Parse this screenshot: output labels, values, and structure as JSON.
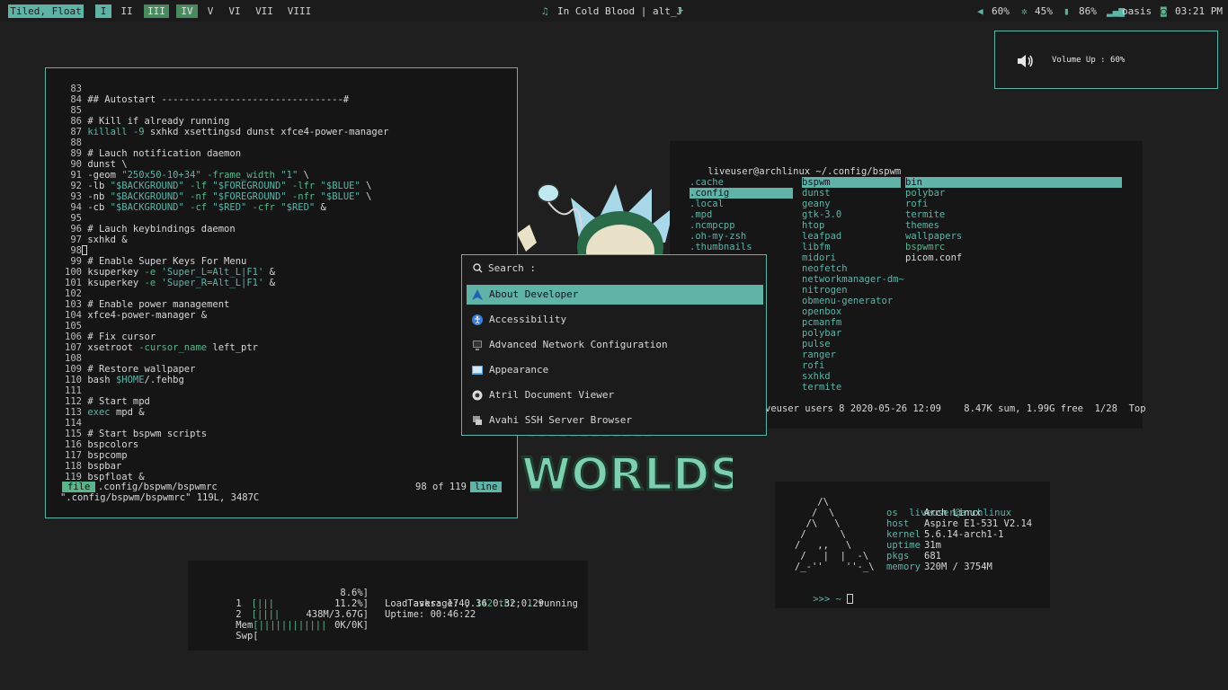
{
  "topbar": {
    "layout": "Tiled, Float",
    "workspaces": [
      {
        "label": "I",
        "state": "active"
      },
      {
        "label": "II",
        "state": "normal"
      },
      {
        "label": "III",
        "state": "occupied"
      },
      {
        "label": "IV",
        "state": "occupied"
      },
      {
        "label": "V",
        "state": "normal"
      },
      {
        "label": "VI",
        "state": "normal"
      },
      {
        "label": "VII",
        "state": "normal"
      },
      {
        "label": "VIII",
        "state": "normal"
      }
    ],
    "music_icon": "music-note-icon",
    "song": "In Cold Blood | alt_J",
    "play_icon": "play-icon",
    "volume": "60%",
    "brightness": "45%",
    "battery": "86%",
    "network": "oasis",
    "time": "03:21 PM"
  },
  "notification": {
    "icon": "speaker-icon",
    "text": "Volume Up : 60%"
  },
  "editor": {
    "lines": [
      {
        "n": "83",
        "t": ""
      },
      {
        "n": "84",
        "t": "## Autostart --------------------------------#"
      },
      {
        "n": "85",
        "t": ""
      },
      {
        "n": "86",
        "t": "# Kill if already running"
      },
      {
        "n": "87",
        "a": "killall",
        "b": " -9",
        "c": " sxhkd xsettingsd dunst xfce4-power-manager"
      },
      {
        "n": "88",
        "t": ""
      },
      {
        "n": "89",
        "t": "# Lauch notification daemon"
      },
      {
        "n": "90",
        "t": "dunst \\"
      },
      {
        "n": "91",
        "a": "-geom ",
        "b": "\"250x50-10+34\"",
        "c": " -frame_width ",
        "d": "\"1\"",
        "e": " \\"
      },
      {
        "n": "92",
        "a": "-lb ",
        "b": "\"$BACKGROUND\"",
        "c": " -lf ",
        "d": "\"$FOREGROUND\"",
        "e": " -lfr ",
        "f": "\"$BLUE\"",
        "g": " \\"
      },
      {
        "n": "93",
        "a": "-nb ",
        "b": "\"$BACKGROUND\"",
        "c": " -nf ",
        "d": "\"$FOREGROUND\"",
        "e": " -nfr ",
        "f": "\"$BLUE\"",
        "g": " \\"
      },
      {
        "n": "94",
        "a": "-cb ",
        "b": "\"$BACKGROUND\"",
        "c": " -cf ",
        "d": "\"$RED\"",
        "e": " -cfr ",
        "f": "\"$RED\"",
        "g": " &"
      },
      {
        "n": "95",
        "t": ""
      },
      {
        "n": "96",
        "t": "# Lauch keybindings daemon"
      },
      {
        "n": "97",
        "t": "sxhkd &"
      },
      {
        "n": "98",
        "t": ""
      },
      {
        "n": "99",
        "t": "# Enable Super Keys For Menu"
      },
      {
        "n": "100",
        "a": "ksuperkey ",
        "b": "-e ",
        "c": "'Super_L=Alt_L|F1'",
        "d": " &"
      },
      {
        "n": "101",
        "a": "ksuperkey ",
        "b": "-e ",
        "c": "'Super_R=Alt_L|F1'",
        "d": " &"
      },
      {
        "n": "102",
        "t": ""
      },
      {
        "n": "103",
        "t": "# Enable power management"
      },
      {
        "n": "104",
        "t": "xfce4-power-manager &"
      },
      {
        "n": "105",
        "t": ""
      },
      {
        "n": "106",
        "t": "# Fix cursor"
      },
      {
        "n": "107",
        "a": "xsetroot ",
        "b": "-cursor_name",
        "c": " left_ptr"
      },
      {
        "n": "108",
        "t": ""
      },
      {
        "n": "109",
        "t": "# Restore wallpaper"
      },
      {
        "n": "110",
        "a": "bash ",
        "b": "$HOME",
        "c": "/.fehbg"
      },
      {
        "n": "111",
        "t": ""
      },
      {
        "n": "112",
        "t": "# Start mpd"
      },
      {
        "n": "113",
        "a": "exec",
        "b": " mpd &"
      },
      {
        "n": "114",
        "t": ""
      },
      {
        "n": "115",
        "t": "# Start bspwm scripts"
      },
      {
        "n": "116",
        "t": "bspcolors"
      },
      {
        "n": "117",
        "t": "bspcomp"
      },
      {
        "n": "118",
        "t": "bspbar"
      },
      {
        "n": "119",
        "t": "bspfloat &"
      }
    ],
    "status_mode": "file",
    "status_path": ".config/bspwm/bspwmrc",
    "status_pos": "98 of 119",
    "status_unit": "line",
    "cmdline": "\".config/bspwm/bspwmrc\" 119L, 3487C"
  },
  "rofi": {
    "search_icon": "search-icon",
    "prompt": "Search :",
    "items": [
      {
        "label": "About Developer",
        "icon": "arch-logo-icon",
        "selected": true
      },
      {
        "label": "Accessibility",
        "icon": "accessibility-icon",
        "selected": false
      },
      {
        "label": "Advanced Network Configuration",
        "icon": "network-icon",
        "selected": false
      },
      {
        "label": "Appearance",
        "icon": "appearance-icon",
        "selected": false
      },
      {
        "label": "Atril Document Viewer",
        "icon": "document-viewer-icon",
        "selected": false
      },
      {
        "label": "Avahi SSH Server Browser",
        "icon": "ssh-icon",
        "selected": false
      }
    ]
  },
  "ranger": {
    "path_user": "liveuser@archlinux",
    "path_dir": " ~/.config/bspwm",
    "col1": [
      ".cache",
      ".config",
      ".local",
      ".mpd",
      ".ncmpcpp",
      ".oh-my-zsh",
      ".thumbnails"
    ],
    "col1_selected": 1,
    "col2": [
      "bspwm",
      "dunst",
      "geany",
      "gtk-3.0",
      "htop",
      "leafpad",
      "libfm",
      "midori",
      "neofetch",
      "networkmanager-dm~",
      "nitrogen",
      "obmenu-generator",
      "openbox",
      "pcmanfm",
      "polybar",
      "pulse",
      "ranger",
      "rofi",
      "sxhkd",
      "termite"
    ],
    "col2_selected": 0,
    "col3": [
      "bin",
      "polybar",
      "rofi",
      "termite",
      "themes",
      "wallpapers",
      "bspwmrc",
      "picom.conf"
    ],
    "col3_selected": 0,
    "status": "veuser users 8 2020-05-26 12:09    8.47K sum, 1.99G free  1/28  Top"
  },
  "htop": {
    "cpu1": {
      "label": "1",
      "bar": "[|||",
      "value": "8.6%]"
    },
    "cpu2": {
      "label": "2",
      "bar": "[||||",
      "value": "11.2%]"
    },
    "mem": {
      "label": "Mem",
      "bar": "[||||||||||||",
      "value": "438M/3.67G]"
    },
    "swp": {
      "label": "Swp",
      "bar": "[",
      "value": "0K/0K]"
    },
    "tasks_a": "Tasks: 174, ",
    "tasks_b": "142 thr",
    "tasks_c": "; ",
    "tasks_d": "1",
    "tasks_e": " running",
    "load": "Load average: 0.36 0.32 0.29",
    "uptime": "Uptime: 00:46:22"
  },
  "neofetch": {
    "logo": [
      "    /\\",
      "   /  \\",
      "  /\\   \\",
      " /      \\",
      "/   ,,   \\",
      " /   |  |  -\\",
      "/_-''    ''-_\\"
    ],
    "title_user": "liveuser",
    "title_host": "@archlinux",
    "info": [
      {
        "k": "os",
        "v": "Arch Linux"
      },
      {
        "k": "host",
        "v": "Aspire E1-531 V2.14"
      },
      {
        "k": "kernel",
        "v": "5.6.14-arch1-1"
      },
      {
        "k": "uptime",
        "v": "31m"
      },
      {
        "k": "pkgs",
        "v": "681"
      },
      {
        "k": "memory",
        "v": "320M / 3754M"
      }
    ],
    "prompt": ">>> ~"
  },
  "wallpaper": {
    "text": "WORLDS"
  }
}
